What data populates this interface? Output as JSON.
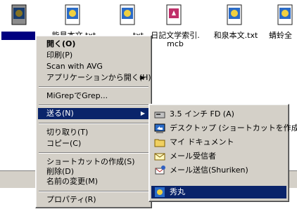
{
  "desktop_files": [
    {
      "name": "",
      "selected": true
    },
    {
      "name": "能見本文.txt",
      "selected": false
    },
    {
      "name": "土佐日記.txt",
      "selected": false
    },
    {
      "name": "日記文学索引.mcb",
      "selected": false,
      "line2": "mcb"
    },
    {
      "name": "和泉本文.txt",
      "selected": false
    },
    {
      "name": "蜻蛉全",
      "selected": false
    }
  ],
  "file_labels": {
    "f1": "能見本文.txt",
    "f2": ".txt",
    "f3a": "日記文学索引.",
    "f3b": "mcb",
    "f4": "和泉本文.txt",
    "f5": "蜻蛉全"
  },
  "context_menu": {
    "open": "開く(O)",
    "print": "印刷(P)",
    "scan": "Scan with AVG",
    "open_with_app": "アプリケーションから開く(H)",
    "migrep": "MiGrepでGrep...",
    "send_to": "送る(N)",
    "cut": "切り取り(T)",
    "copy": "コピー(C)",
    "create_shortcut": "ショートカットの作成(S)",
    "delete": "削除(D)",
    "rename": "名前の変更(M)",
    "properties": "プロパティ(R)"
  },
  "send_to_menu": {
    "floppy": "3.5 インチ FD (A)",
    "desktop": "デスクトップ (ショートカットを作成)",
    "my_documents": "マイ ドキュメント",
    "mail_recipient": "メール受信者",
    "shuriken": "メール送信(Shuriken)",
    "hidemaru": "秀丸"
  },
  "colors": {
    "menu_bg": "#d4d0c8",
    "highlight": "#0a246a",
    "selection": "#000080"
  }
}
